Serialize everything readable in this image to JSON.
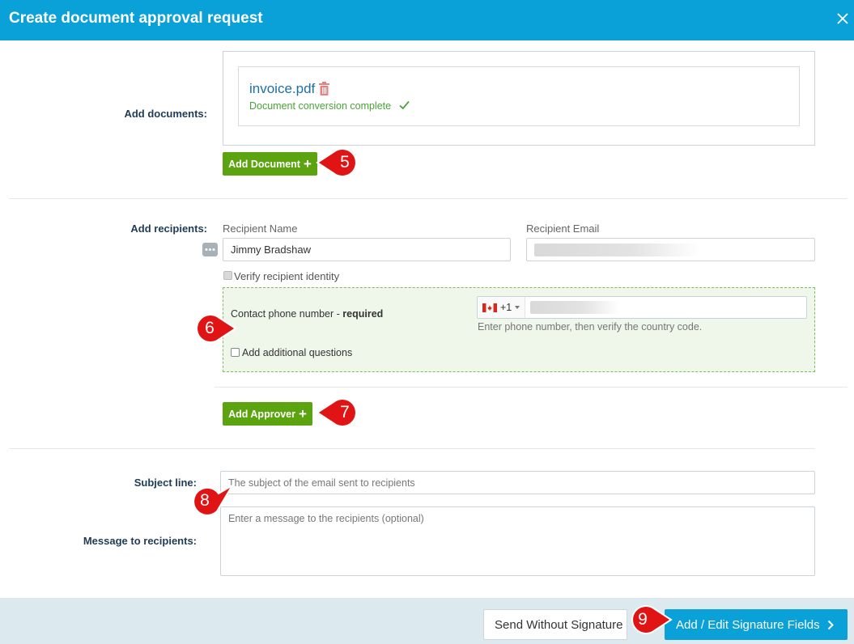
{
  "dialog": {
    "title": "Create document approval request"
  },
  "documents": {
    "label": "Add documents:",
    "file_name": "invoice.pdf",
    "status": "Document conversion complete",
    "add_button": "Add Document"
  },
  "recipients": {
    "label": "Add recipients:",
    "name_header": "Recipient Name",
    "email_header": "Recipient Email",
    "name_value": "Jimmy Bradshaw",
    "verify_label": "Verify recipient identity",
    "phone_label": "Contact phone number - ",
    "phone_required": "required",
    "country_code": "+1",
    "phone_hint": "Enter phone number, then verify the country code.",
    "additional_questions": "Add additional questions",
    "add_approver": "Add Approver"
  },
  "message": {
    "subject_label": "Subject line:",
    "subject_placeholder": "The subject of the email sent to recipients",
    "message_label": "Message to recipients:",
    "message_placeholder": "Enter a message to the recipients (optional)"
  },
  "footer": {
    "send_without": "Send Without Signature",
    "add_edit": "Add / Edit Signature Fields"
  },
  "callouts": [
    "5",
    "6",
    "7",
    "8",
    "9"
  ],
  "colors": {
    "header": "#0aa0d8",
    "green_button": "#5ca40f",
    "callout": "#e01414",
    "link": "#1d6fa5",
    "success": "#49a337"
  },
  "icons": [
    "close-icon",
    "trash-icon",
    "check-icon",
    "plus-icon",
    "more-icon",
    "canada-flag-icon",
    "caret-down-icon",
    "chevron-right-icon"
  ]
}
